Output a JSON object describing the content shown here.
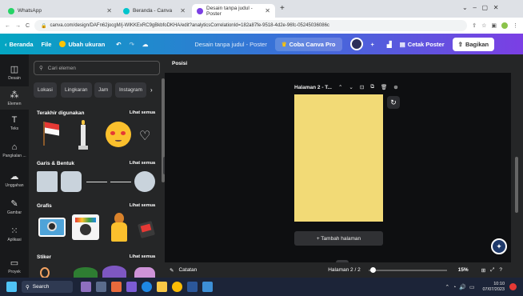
{
  "browser": {
    "tabs": [
      {
        "label": "WhatsApp",
        "color": "#25d366"
      },
      {
        "label": "Beranda - Canva",
        "color": "#00c4cc"
      },
      {
        "label": "Desain tanpa judul - Poster",
        "color": "#00c4cc"
      }
    ],
    "url": "canva.com/design/DAFn62jocgM/j-WIKKExRC9gBkbfoDKHA/edit?analyticsCorrelationId=182a87fe-9518-4d2e-96fc-05245036086c"
  },
  "topbar": {
    "home": "Beranda",
    "file": "File",
    "resize": "Ubah ukuran",
    "title": "Desain tanpa judul - Poster",
    "pro": "Coba Canva Pro",
    "print": "Cetak Poster",
    "share": "Bagikan"
  },
  "rail": {
    "items": [
      "Desain",
      "Elemen",
      "Teks",
      "Pangkalan ...",
      "Unggahan",
      "Gambar",
      "Aplikasi",
      "Proyek"
    ]
  },
  "panel": {
    "search_placeholder": "Cari elemen",
    "chips": [
      "Lokasi",
      "Lingkaran",
      "Jam",
      "Instagram"
    ],
    "sections": {
      "recent": "Terakhir digunakan",
      "lines": "Garis & Bentuk",
      "graphics": "Grafis",
      "stickers": "Stiker"
    },
    "see_all": "Lihat semua"
  },
  "editor": {
    "position": "Posisi",
    "page_label": "Halaman 2 - T...",
    "add_page": "+ Tambah halaman",
    "notes": "Catatan",
    "page_counter": "Halaman 2 / 2",
    "zoom": "15%",
    "page_color": "#f2da76",
    "zoom_level": 0.15
  },
  "taskbar": {
    "search": "Search",
    "time": "10:10",
    "date": "07/07/2023"
  }
}
